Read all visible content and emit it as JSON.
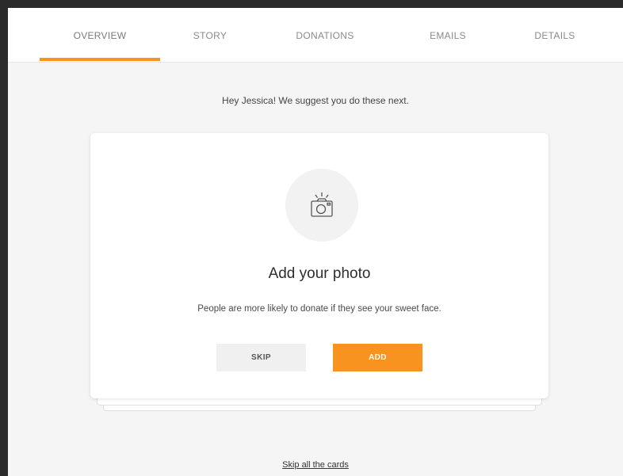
{
  "tabs": [
    {
      "label": "OVERVIEW",
      "active": true
    },
    {
      "label": "STORY",
      "active": false
    },
    {
      "label": "DONATIONS",
      "active": false
    },
    {
      "label": "EMAILS",
      "active": false
    },
    {
      "label": "DETAILS",
      "active": false
    }
  ],
  "suggestion_text": "Hey Jessica! We suggest you do these next.",
  "card": {
    "icon": "camera-icon",
    "title": "Add your photo",
    "subtitle": "People are more likely to donate if they see your sweet face.",
    "skip_label": "SKIP",
    "add_label": "ADD"
  },
  "skip_all_label": "Skip all the cards",
  "colors": {
    "accent": "#f7931e",
    "frame": "#2b2b2b",
    "background": "#f5f5f5"
  }
}
